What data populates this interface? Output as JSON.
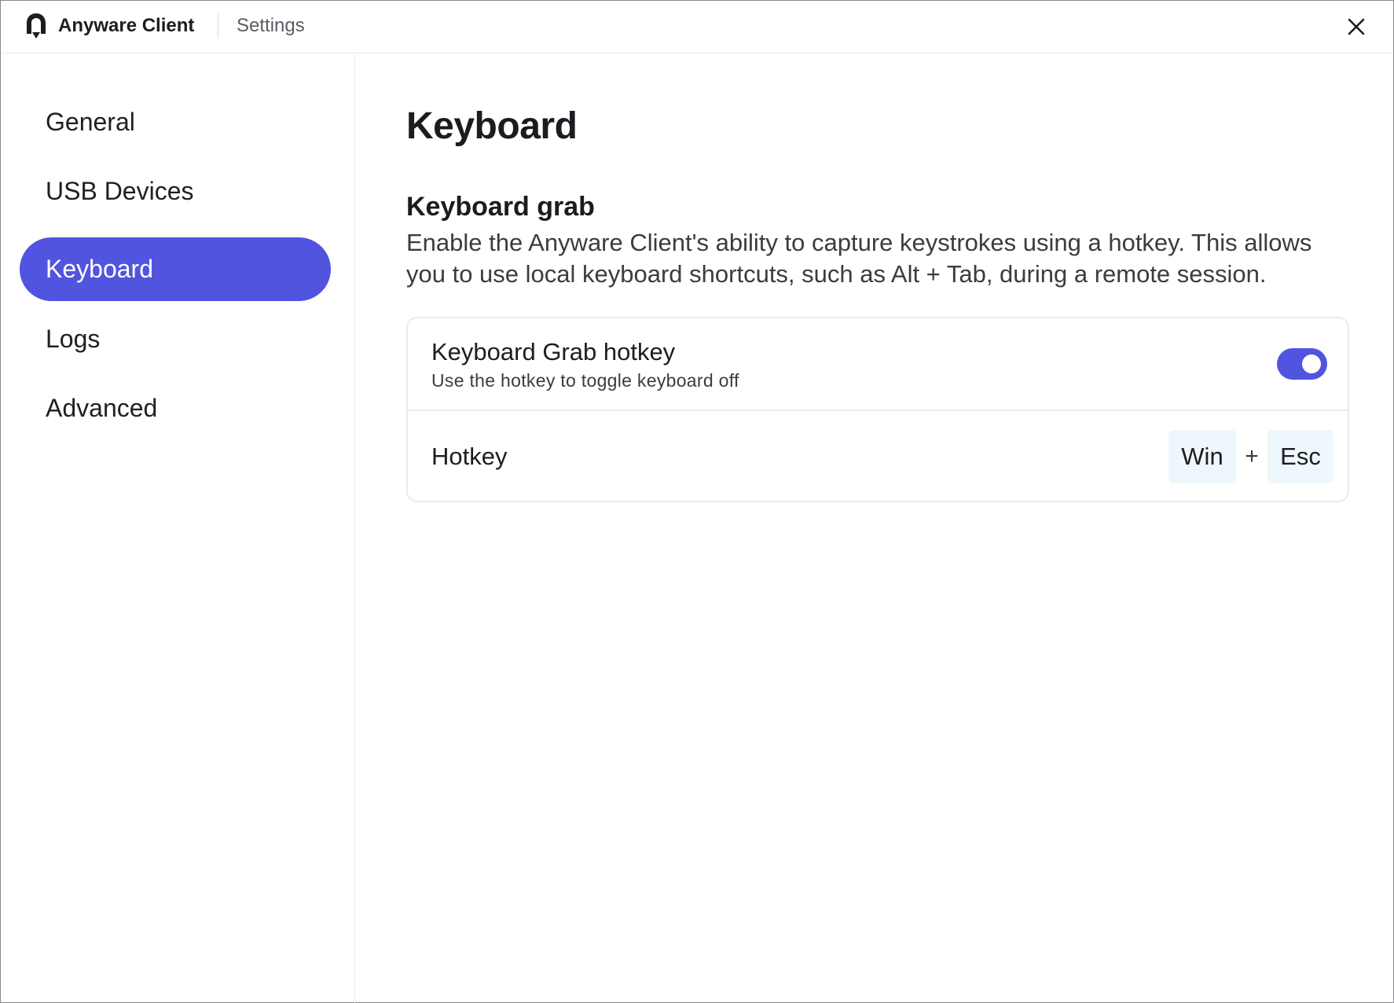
{
  "titlebar": {
    "app_name": "Anyware Client",
    "section": "Settings",
    "logo_icon": "anyware-logo-icon",
    "close_icon": "close-icon"
  },
  "sidebar": {
    "items": [
      {
        "label": "General",
        "active": false
      },
      {
        "label": "USB Devices",
        "active": false
      },
      {
        "label": "Keyboard",
        "active": true
      },
      {
        "label": "Logs",
        "active": false
      },
      {
        "label": "Advanced",
        "active": false
      }
    ]
  },
  "main": {
    "title": "Keyboard",
    "section_title": "Keyboard grab",
    "section_desc": "Enable the Anyware Client's ability to capture keystrokes using a hotkey. This allows you to use local keyboard shortcuts, such as Alt + Tab, during a remote session.",
    "grab_setting": {
      "title": "Keyboard Grab hotkey",
      "subtitle": "Use the hotkey to toggle keyboard off",
      "enabled": true
    },
    "hotkey": {
      "label": "Hotkey",
      "key1": "Win",
      "separator": "+",
      "key2": "Esc"
    }
  },
  "colors": {
    "accent": "#5154df",
    "key_bg": "#eef7fc",
    "border": "#e9eaee"
  }
}
